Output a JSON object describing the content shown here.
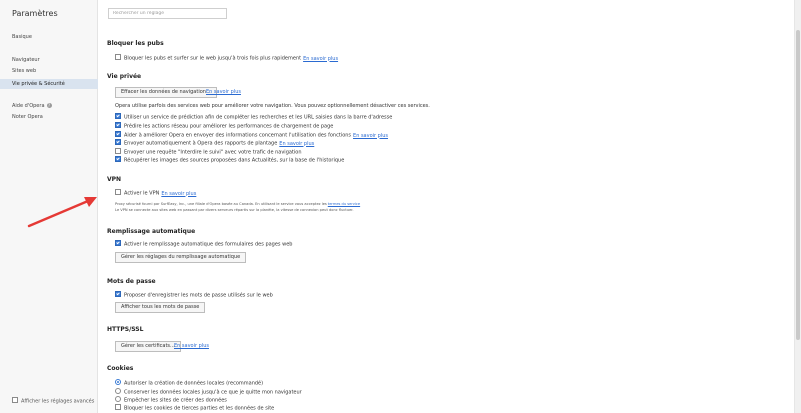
{
  "sidebar": {
    "title": "Paramètres",
    "items": [
      {
        "label": "Basique"
      },
      {
        "label": "Navigateur"
      },
      {
        "label": "Sites web"
      },
      {
        "label": "Vie privée & Sécurité"
      },
      {
        "label": "Aide d'Opera"
      },
      {
        "label": "Noter Opera"
      }
    ],
    "advanced_label": "Afficher les réglages avancés"
  },
  "search": {
    "placeholder": "Rechercher un réglage"
  },
  "ads": {
    "title": "Bloquer les pubs",
    "row": "Bloquer les pubs et surfer sur le web jusqu'à trois fois plus rapidement",
    "link": "En savoir plus"
  },
  "privacy": {
    "title": "Vie privée",
    "clear_button": "Effacer les données de navigation...",
    "clear_link": "En savoir plus",
    "intro": "Opera utilise parfois des services web pour améliorer votre navigation. Vous pouvez optionnellement désactiver ces services.",
    "options": [
      {
        "label": "Utiliser un service de prédiction afin de compléter les recherches et les URL saisies dans la barre d'adresse",
        "checked": true,
        "link": ""
      },
      {
        "label": "Prédire les actions réseau pour améliorer les performances de chargement de page",
        "checked": true,
        "link": ""
      },
      {
        "label": "Aider à améliorer Opera en envoyer des informations concernant l'utilisation des fonctions",
        "checked": true,
        "link": "En savoir plus"
      },
      {
        "label": "Envoyer automatiquement à Opera des rapports de plantage",
        "checked": true,
        "link": "En savoir plus"
      },
      {
        "label": "Envoyer une requête \"Interdire le suivi\" avec votre trafic de navigation",
        "checked": false,
        "link": ""
      },
      {
        "label": "Récupérer les images des sources proposées dans Actualités, sur la base de l'historique",
        "checked": true,
        "link": ""
      }
    ]
  },
  "vpn": {
    "title": "VPN",
    "row": "Activer le VPN",
    "link": "En savoir plus",
    "fine1": "Proxy sécurisé fourni par SurfEasy, Inc., une filiale d'Opera basée au Canada. En utilisant le service vous acceptez les",
    "fine1_link": "termes du service",
    "fine2": "Le VPN se connecte aux sites web en passant par divers serveurs répartis sur la planète, la vitesse de connexion peut donc fluctuer."
  },
  "autofill": {
    "title": "Remplissage automatique",
    "row": "Activer le remplissage automatique des formulaires des pages web",
    "button": "Gérer les réglages du remplissage automatique"
  },
  "passwords": {
    "title": "Mots de passe",
    "row": "Proposer d'enregistrer les mots de passe utilisés sur le web",
    "button": "Afficher tous les mots de passe"
  },
  "https": {
    "title": "HTTPS/SSL",
    "button": "Gérer les certificats...",
    "link": "En savoir plus"
  },
  "cookies": {
    "title": "Cookies",
    "options": [
      {
        "label": "Autoriser la création de données locales (recommandé)",
        "type": "radio",
        "checked": true
      },
      {
        "label": "Conserver les données locales jusqu'à ce que je quitte mon navigateur",
        "type": "radio",
        "checked": false
      },
      {
        "label": "Empêcher les sites de créer des données",
        "type": "radio",
        "checked": false
      },
      {
        "label": "Bloquer les cookies de tierces parties et les données de site",
        "type": "checkbox",
        "checked": false
      }
    ]
  },
  "colors": {
    "accent": "#3a7bd5",
    "link": "#2a6ad1",
    "arrow": "#e53935",
    "active_bg": "#d9e3ef"
  }
}
